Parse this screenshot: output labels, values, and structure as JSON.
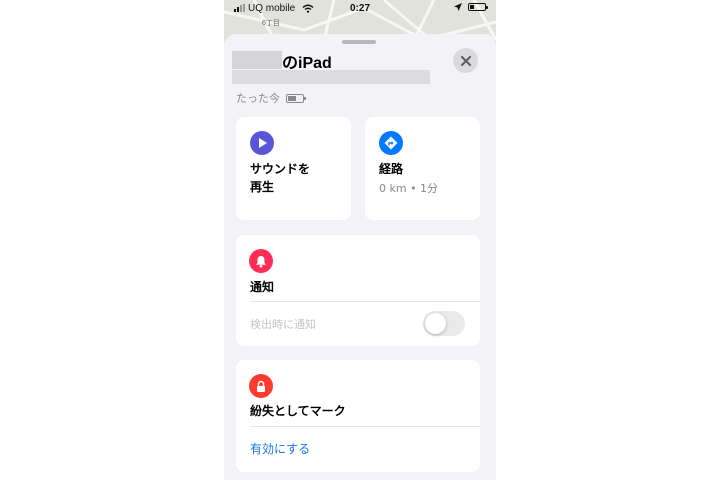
{
  "status_bar": {
    "carrier": "UQ mobile",
    "time": "0:27"
  },
  "map": {
    "label": "6丁目"
  },
  "sheet": {
    "device_title": "のiPad",
    "timestamp": "たった今"
  },
  "actions": {
    "sound": {
      "label_line1": "サウンドを",
      "label_line2": "再生",
      "icon": "play-icon",
      "color": "#5856d6"
    },
    "route": {
      "label": "経路",
      "detail": "0 km • 1分",
      "icon": "directions-arrow-icon",
      "color": "#007aff"
    }
  },
  "notify": {
    "title": "通知",
    "row_label": "検出時に通知",
    "toggle_on": false,
    "icon": "bell-icon",
    "color": "#ff2d55"
  },
  "lost_mode": {
    "title": "紛失としてマーク",
    "action_label": "有効にする",
    "icon": "lock-icon",
    "color": "#ff3b30"
  },
  "colors": {
    "link": "#1a73e8",
    "sheet_background": "#f2f2f7",
    "card_background": "#ffffff",
    "secondary_text": "#8a8a8e"
  }
}
